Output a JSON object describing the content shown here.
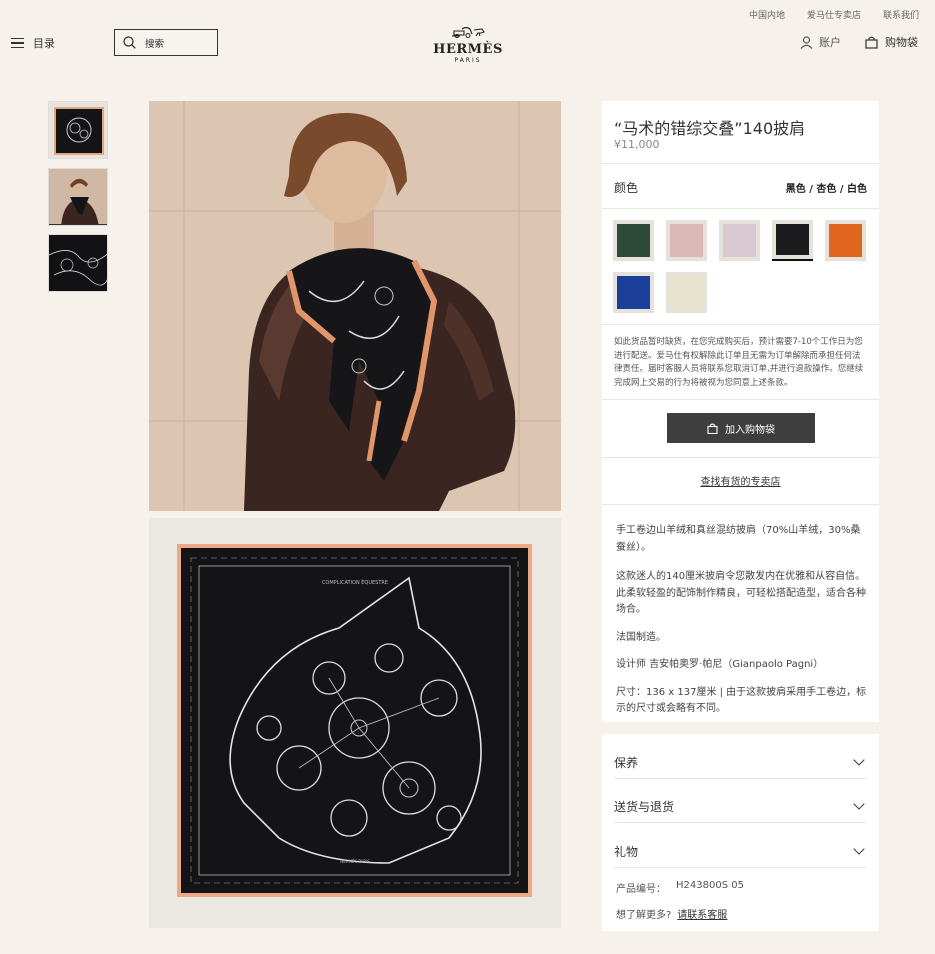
{
  "top_links": [
    "中国内地",
    "爱马仕专卖店",
    "联系我们"
  ],
  "header": {
    "menu_label": "目录",
    "search_placeholder": "搜索",
    "logo_word": "HERMÈS",
    "logo_sub": "PARIS",
    "account_label": "账户",
    "bag_label": "购物袋"
  },
  "product": {
    "title": "“马术的错综交叠”140披肩",
    "price": "¥11,000",
    "color_label": "颜色",
    "color_value": "黑色 / 杏色 / 白色",
    "swatches": [
      {
        "name": "green",
        "color": "#2e4a3a",
        "selected": false
      },
      {
        "name": "pink",
        "color": "#d9b8b6",
        "selected": false
      },
      {
        "name": "lilac",
        "color": "#d8c8cf",
        "selected": false
      },
      {
        "name": "black",
        "color": "#1b1b1d",
        "selected": true
      },
      {
        "name": "orange",
        "color": "#e0661f",
        "selected": false
      },
      {
        "name": "blue",
        "color": "#1c3f9a",
        "selected": false
      },
      {
        "name": "cream",
        "color": "#e8e3cc",
        "selected": false
      }
    ],
    "notice": "如此货品暂时缺货，在您完成购买后，预计需要7-10个工作日为您进行配送。爱马仕有权解除此订单且无需为订单解除而承担任何法律责任。届时客服人员将联系您取消订单,并进行退款操作。您继续完成网上交易的行为将被视为您同意上述条款。",
    "add_to_bag": "加入购物袋",
    "find_store": "查找有货的专卖店",
    "desc_1": "手工卷边山羊绒和真丝混纺披肩（70%山羊绒，30%桑蚕丝）。",
    "desc_2": "这款迷人的140厘米披肩令您散发内在优雅和从容自信。此柔软轻盈的配饰制作精良，可轻松搭配造型，适合各种场合。",
    "desc_3": "法国制造。",
    "desc_4": "设计师 吉安帕奥罗·帕尼（Gianpaolo Pagni）",
    "desc_5": "尺寸：136 x 137厘米 | 由于这款披肩采用手工卷边，标示的尺寸或会略有不同。",
    "accordion": [
      "保养",
      "送货与退货",
      "礼物"
    ],
    "sku_label": "产品编号：",
    "sku_value": "H243800S 05",
    "more_q": "想了解更多?",
    "contact_link": "请联系客服"
  },
  "scarf_text": {
    "title": "COMPLICATION ÉQUESTRE",
    "brand": "HERMÈS PARIS"
  }
}
